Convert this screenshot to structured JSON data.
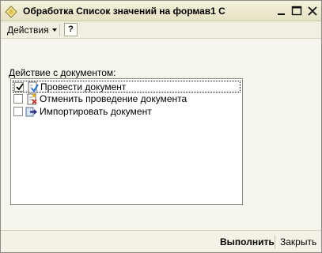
{
  "window": {
    "title": "Обработка  Список значений на формав1 С"
  },
  "toolbar": {
    "actions_label": "Действия",
    "help_label": "?"
  },
  "form": {
    "field_label": "Действие с документом:",
    "items": [
      {
        "label": "Провести документ",
        "checked": true,
        "icon": "post-document-icon"
      },
      {
        "label": "Отменить проведение документа",
        "checked": false,
        "icon": "cancel-posting-icon"
      },
      {
        "label": "Импортировать документ",
        "checked": false,
        "icon": "import-document-icon"
      }
    ]
  },
  "buttons": {
    "run_label": "Выполнить",
    "close_label": "Закрыть"
  }
}
